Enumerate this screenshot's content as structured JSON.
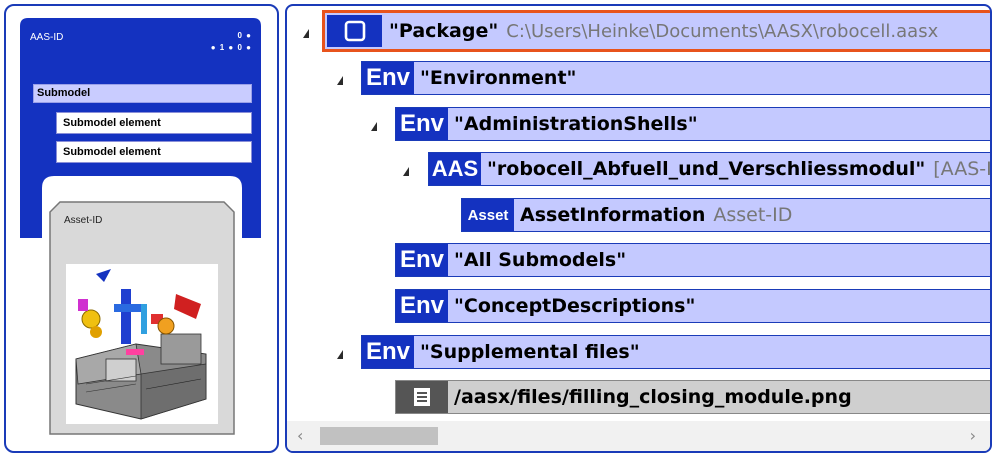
{
  "shell_card": {
    "aas_id_label": "AAS-ID",
    "bits_line1": "0 ●",
    "bits_line2": "● 1 ● 0 ●",
    "submodel_label": "Submodel",
    "submodel_elements": [
      "Submodel element",
      "Submodel element"
    ],
    "asset_id_label": "Asset-ID"
  },
  "tree": {
    "nodes": [
      {
        "badge": "package-icon",
        "title": "\"Package\"",
        "sub": "C:\\Users\\Heinke\\Documents\\AASX\\robocell.aasx"
      },
      {
        "badge": "Env",
        "title": "\"Environment\"",
        "sub": ""
      },
      {
        "badge": "Env",
        "title": "\"AdministrationShells\"",
        "sub": ""
      },
      {
        "badge": "AAS",
        "title": "\"robocell_Abfuell_und_Verschliessmodul\"",
        "sub": "[AAS-ID]"
      },
      {
        "badge": "Asset",
        "title": "AssetInformation",
        "sub": "Asset-ID"
      },
      {
        "badge": "Env",
        "title": "\"All Submodels\"",
        "sub": ""
      },
      {
        "badge": "Env",
        "title": "\"ConceptDescriptions\"",
        "sub": ""
      },
      {
        "badge": "Env",
        "title": "\"Supplemental files\"",
        "sub": ""
      },
      {
        "badge": "file-icon",
        "title": "/aasx/files/filling_closing_module.png",
        "sub": ""
      }
    ]
  },
  "scrollbar": {
    "left_arrow": "‹",
    "right_arrow": "›"
  },
  "colors": {
    "accent": "#1432c0",
    "node_bg": "#c4c9ff",
    "selection": "#e8531c",
    "file_bg": "#cfcfcf"
  }
}
